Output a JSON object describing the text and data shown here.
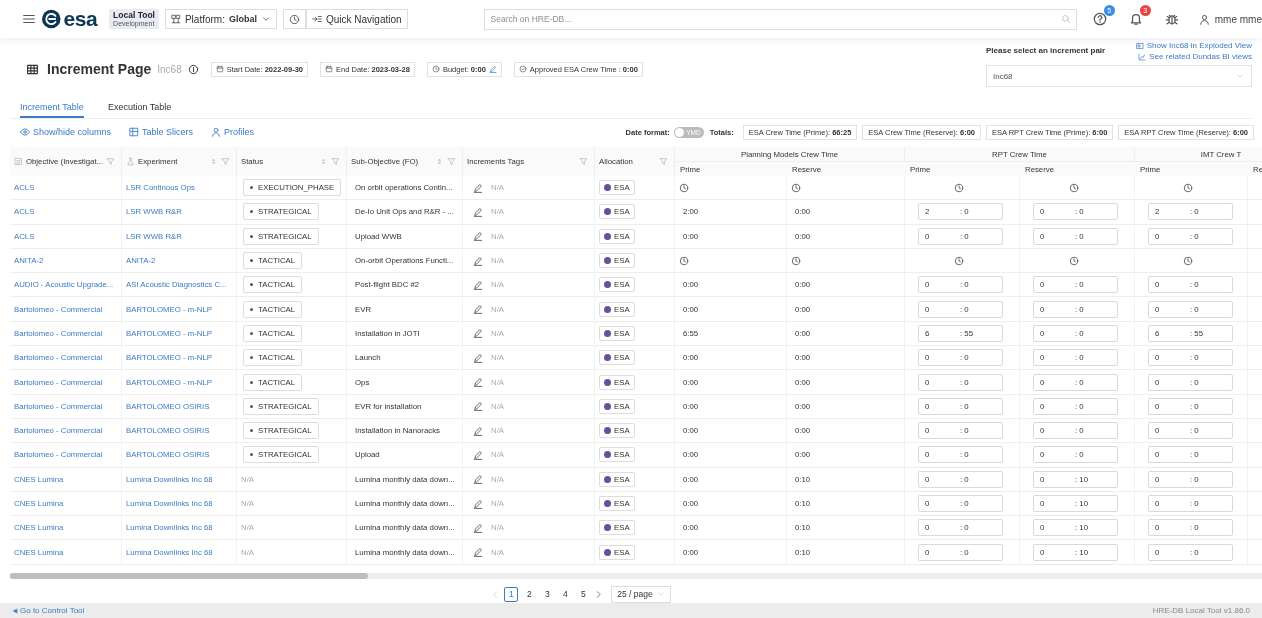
{
  "topbar": {
    "logo": "esa",
    "org_tag": "Local Tool",
    "org_sub": "Development",
    "platform_label": "Platform:",
    "platform_value": "Global",
    "quick_nav": "Quick Navigation",
    "search_placeholder": "Search on HRE-DB...",
    "help_count": "5",
    "notif_count": "3",
    "user": "mme mme"
  },
  "page": {
    "title": "Increment Page",
    "increment": "Inc68",
    "chips": [
      {
        "kind": "calendar",
        "label": "Start Date:",
        "value": "2022-09-30"
      },
      {
        "kind": "calendar",
        "label": "End Date:",
        "value": "2023-03-28"
      },
      {
        "kind": "budget",
        "label": "Budget:",
        "value": "0:00"
      },
      {
        "kind": "approved",
        "label": "Approved ESA Crew Time :",
        "value": "0:00"
      }
    ],
    "pair_label": "Please select an increment pair",
    "pair_value": "Inc68",
    "links": [
      "Show Inc68 in Exploded View",
      "See related Dundas BI views"
    ]
  },
  "tabs": [
    {
      "label": "Increment Table",
      "selected": true
    },
    {
      "label": "Execution Table",
      "selected": false
    }
  ],
  "toolbar": {
    "actions": [
      "Show/hide columns",
      "Table Slicers",
      "Profiles"
    ],
    "date_format_label": "Date format:",
    "date_format_toggle": "YMD",
    "date_format_on": false,
    "totals_label": "Totals:",
    "totals": [
      {
        "label": "ESA Crew Time (Prime):",
        "value": "66:25"
      },
      {
        "label": "ESA Crew Time (Reserve):",
        "value": "6:00"
      },
      {
        "label": "ESA RPT Crew Time (Prime):",
        "value": "6:00"
      },
      {
        "label": "ESA RPT Crew Time (Reserve):",
        "value": "6:00"
      }
    ]
  },
  "table": {
    "columns": [
      {
        "label": "Objective (Investigat...",
        "sortable": false
      },
      {
        "label": "Experiment",
        "sortable": true
      },
      {
        "label": "Status",
        "sortable": true
      },
      {
        "label": "Sub-Objective (FO)",
        "sortable": true
      },
      {
        "label": "Increments Tags",
        "sortable": false
      },
      {
        "label": "Allocation",
        "sortable": false
      }
    ],
    "groups": [
      {
        "label": "Planning Models Crew Time",
        "sub": [
          "Prime",
          "Reserve"
        ]
      },
      {
        "label": "RPT Crew Time",
        "sub": [
          "Prime",
          "Reserve"
        ]
      },
      {
        "label": "IMT Crew T",
        "sub": [
          "Prime",
          "Re"
        ]
      }
    ],
    "time_separator": ":",
    "rows": [
      {
        "kind": "pending",
        "objective": "ACLS",
        "experiment": "LSR Continous Ops",
        "status": {
          "kind": "chip",
          "text": "EXECUTION_PHASE"
        },
        "sub_objective": "On orbit operations Contin...",
        "tags": "N/A",
        "allocation": "ESA"
      },
      {
        "kind": "values",
        "objective": "ACLS",
        "experiment": "LSR WWB R&R",
        "status": {
          "kind": "chip",
          "text": "STRATEGICAL"
        },
        "sub_objective": "De-Io Unit Ops and R&R - ...",
        "tags": "N/A",
        "allocation": "ESA",
        "planning": [
          "2:00",
          "0:00"
        ],
        "rpt": [
          [
            "2",
            "0"
          ],
          [
            "0",
            "0"
          ]
        ],
        "imt": [
          [
            "2",
            "0"
          ]
        ]
      },
      {
        "kind": "values",
        "objective": "ACLS",
        "experiment": "LSR WWB R&R",
        "status": {
          "kind": "chip",
          "text": "STRATEGICAL"
        },
        "sub_objective": "Upload WWB",
        "tags": "N/A",
        "allocation": "ESA",
        "planning": [
          "0:00",
          "0:00"
        ],
        "rpt": [
          [
            "0",
            "0"
          ],
          [
            "0",
            "0"
          ]
        ],
        "imt": [
          [
            "0",
            "0"
          ]
        ]
      },
      {
        "kind": "pending",
        "objective": "ANITA-2",
        "experiment": "ANITA-2",
        "status": {
          "kind": "chip",
          "text": "TACTICAL"
        },
        "sub_objective": "On-orbit Operations Functi...",
        "tags": "N/A",
        "allocation": "ESA"
      },
      {
        "kind": "values",
        "objective": "AUDIO - Acoustic Upgrade...",
        "experiment": "ASI Acoustic Diagnostics C...",
        "status": {
          "kind": "chip",
          "text": "TACTICAL"
        },
        "sub_objective": "Post-flight BDC #2",
        "tags": "N/A",
        "allocation": "ESA",
        "planning": [
          "0:00",
          "0:00"
        ],
        "rpt": [
          [
            "0",
            "0"
          ],
          [
            "0",
            "0"
          ]
        ],
        "imt": [
          [
            "0",
            "0"
          ]
        ]
      },
      {
        "kind": "values",
        "objective": "Bartolomeo - Commercial",
        "experiment": "BARTOLOMEO - m-NLP",
        "status": {
          "kind": "chip",
          "text": "TACTICAL"
        },
        "sub_objective": "EVR",
        "tags": "N/A",
        "allocation": "ESA",
        "planning": [
          "0:00",
          "0:00"
        ],
        "rpt": [
          [
            "0",
            "0"
          ],
          [
            "0",
            "0"
          ]
        ],
        "imt": [
          [
            "0",
            "0"
          ]
        ]
      },
      {
        "kind": "values",
        "objective": "Bartolomeo - Commercial",
        "experiment": "BARTOLOMEO - m-NLP",
        "status": {
          "kind": "chip",
          "text": "TACTICAL"
        },
        "sub_objective": "Installation in JOTI",
        "tags": "N/A",
        "allocation": "ESA",
        "planning": [
          "6:55",
          "0:00"
        ],
        "rpt": [
          [
            "6",
            "55"
          ],
          [
            "0",
            "0"
          ]
        ],
        "imt": [
          [
            "6",
            "55"
          ]
        ]
      },
      {
        "kind": "values",
        "objective": "Bartolomeo - Commercial",
        "experiment": "BARTOLOMEO - m-NLP",
        "status": {
          "kind": "chip",
          "text": "TACTICAL"
        },
        "sub_objective": "Launch",
        "tags": "N/A",
        "allocation": "ESA",
        "planning": [
          "0:00",
          "0:00"
        ],
        "rpt": [
          [
            "0",
            "0"
          ],
          [
            "0",
            "0"
          ]
        ],
        "imt": [
          [
            "0",
            "0"
          ]
        ]
      },
      {
        "kind": "values",
        "objective": "Bartolomeo - Commercial",
        "experiment": "BARTOLOMEO - m-NLP",
        "status": {
          "kind": "chip",
          "text": "TACTICAL"
        },
        "sub_objective": "Ops",
        "tags": "N/A",
        "allocation": "ESA",
        "planning": [
          "0:00",
          "0:00"
        ],
        "rpt": [
          [
            "0",
            "0"
          ],
          [
            "0",
            "0"
          ]
        ],
        "imt": [
          [
            "0",
            "0"
          ]
        ]
      },
      {
        "kind": "values",
        "objective": "Bartolomeo - Commercial",
        "experiment": "BARTOLOMEO OSIRIS",
        "status": {
          "kind": "chip",
          "text": "STRATEGICAL"
        },
        "sub_objective": "EVR for installation",
        "tags": "N/A",
        "allocation": "ESA",
        "planning": [
          "0:00",
          "0:00"
        ],
        "rpt": [
          [
            "0",
            "0"
          ],
          [
            "0",
            "0"
          ]
        ],
        "imt": [
          [
            "0",
            "0"
          ]
        ]
      },
      {
        "kind": "values",
        "objective": "Bartolomeo - Commercial",
        "experiment": "BARTOLOMEO OSIRIS",
        "status": {
          "kind": "chip",
          "text": "STRATEGICAL"
        },
        "sub_objective": "Installation in Nanoracks",
        "tags": "N/A",
        "allocation": "ESA",
        "planning": [
          "0:00",
          "0:00"
        ],
        "rpt": [
          [
            "0",
            "0"
          ],
          [
            "0",
            "0"
          ]
        ],
        "imt": [
          [
            "0",
            "0"
          ]
        ]
      },
      {
        "kind": "values",
        "objective": "Bartolomeo - Commercial",
        "experiment": "BARTOLOMEO OSIRIS",
        "status": {
          "kind": "chip",
          "text": "STRATEGICAL"
        },
        "sub_objective": "Upload",
        "tags": "N/A",
        "allocation": "ESA",
        "planning": [
          "0:00",
          "0:00"
        ],
        "rpt": [
          [
            "0",
            "0"
          ],
          [
            "0",
            "0"
          ]
        ],
        "imt": [
          [
            "0",
            "0"
          ]
        ]
      },
      {
        "kind": "values",
        "objective": "CNES Lumina",
        "experiment": "Lumina Downlinks Inc 68",
        "status": {
          "kind": "plain",
          "text": "N/A"
        },
        "sub_objective": "Lumina monthly data down...",
        "tags": "N/A",
        "allocation": "ESA",
        "planning": [
          "0:00",
          "0:10"
        ],
        "rpt": [
          [
            "0",
            "0"
          ],
          [
            "0",
            "10"
          ]
        ],
        "imt": [
          [
            "0",
            "0"
          ]
        ]
      },
      {
        "kind": "values",
        "objective": "CNES Lumina",
        "experiment": "Lumina Downlinks Inc 68",
        "status": {
          "kind": "plain",
          "text": "N/A"
        },
        "sub_objective": "Lumina monthly data down...",
        "tags": "N/A",
        "allocation": "ESA",
        "planning": [
          "0:00",
          "0:10"
        ],
        "rpt": [
          [
            "0",
            "0"
          ],
          [
            "0",
            "10"
          ]
        ],
        "imt": [
          [
            "0",
            "0"
          ]
        ]
      },
      {
        "kind": "values",
        "objective": "CNES Lumina",
        "experiment": "Lumina Downlinks Inc 68",
        "status": {
          "kind": "plain",
          "text": "N/A"
        },
        "sub_objective": "Lumina monthly data down...",
        "tags": "N/A",
        "allocation": "ESA",
        "planning": [
          "0:00",
          "0:10"
        ],
        "rpt": [
          [
            "0",
            "0"
          ],
          [
            "0",
            "10"
          ]
        ],
        "imt": [
          [
            "0",
            "0"
          ]
        ]
      },
      {
        "kind": "values",
        "objective": "CNES Lumina",
        "experiment": "Lumina Downlinks Inc 68",
        "status": {
          "kind": "plain",
          "text": "N/A"
        },
        "sub_objective": "Lumina monthly data down...",
        "tags": "N/A",
        "allocation": "ESA",
        "planning": [
          "0:00",
          "0:10"
        ],
        "rpt": [
          [
            "0",
            "0"
          ],
          [
            "0",
            "10"
          ]
        ],
        "imt": [
          [
            "0",
            "0"
          ]
        ]
      }
    ]
  },
  "pagination": {
    "pages": [
      {
        "label": "1",
        "selected": true
      },
      {
        "label": "2",
        "selected": false
      },
      {
        "label": "3",
        "selected": false
      },
      {
        "label": "4",
        "selected": false
      },
      {
        "label": "5",
        "selected": false
      }
    ],
    "page_size": "25 / page"
  },
  "footer": {
    "back_link": "Go to Control Tool",
    "version": "HRE-DB Local Tool v1.86.0"
  }
}
